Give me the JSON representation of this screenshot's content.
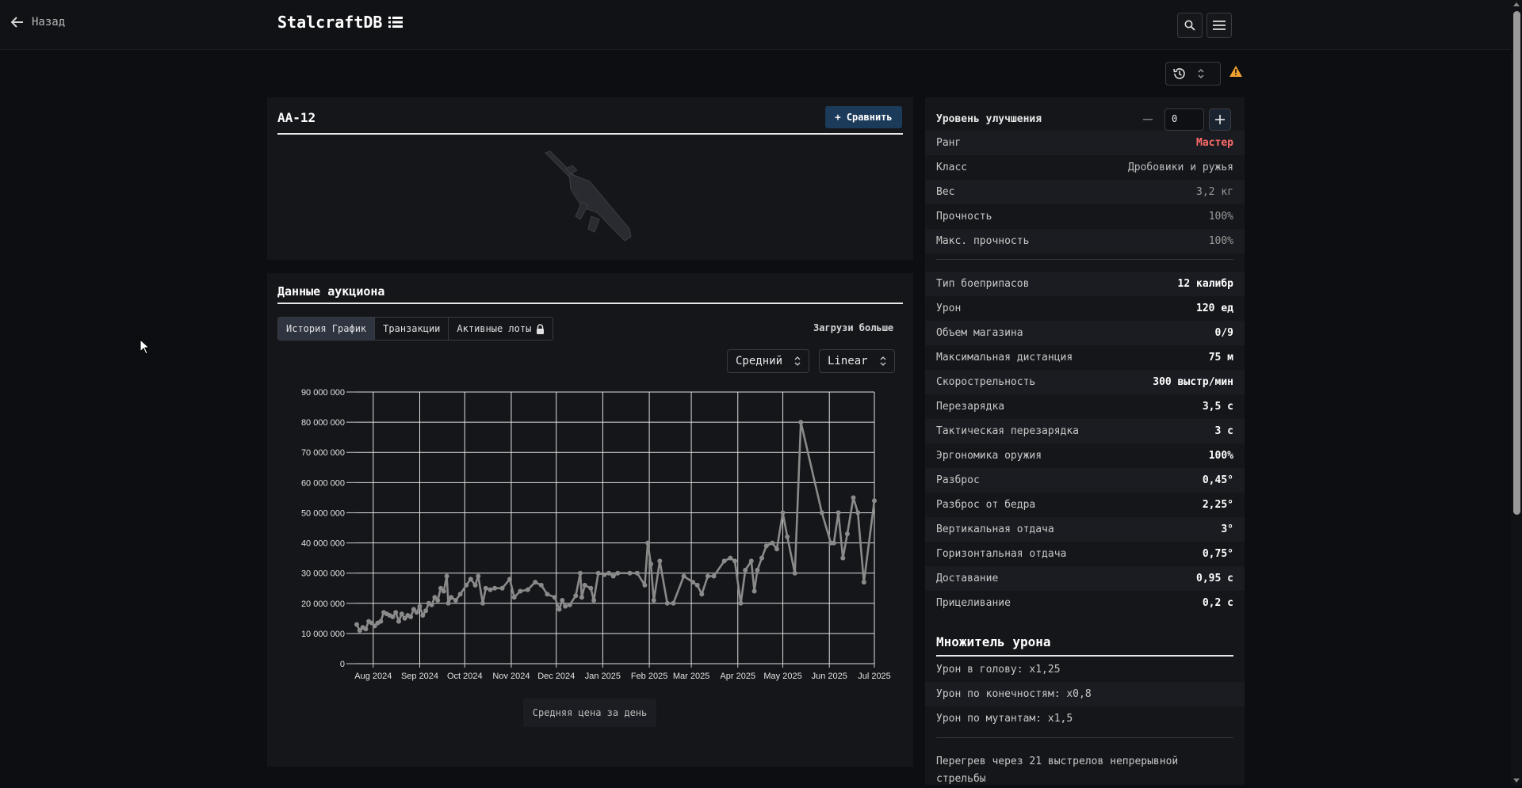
{
  "nav": {
    "back_label": "Назад",
    "brand": "StalcraftDB"
  },
  "item": {
    "name": "AA-12",
    "compare_label": "+ Сравнить"
  },
  "auction": {
    "title": "Данные аукциона",
    "tabs": [
      {
        "label": "История График",
        "active": true
      },
      {
        "label": "Транзакции",
        "active": false
      },
      {
        "label": "Активные лоты",
        "active": false
      }
    ],
    "load_more": "Загрузи больше",
    "mode_select": "Средний",
    "scale_select": "Linear",
    "caption": "Средняя цена за день"
  },
  "chart_data": {
    "type": "line",
    "ylim": [
      0,
      90000000
    ],
    "y_ticks": [
      {
        "v": 0,
        "label": "0"
      },
      {
        "v": 10000000,
        "label": "10 000 000"
      },
      {
        "v": 20000000,
        "label": "20 000 000"
      },
      {
        "v": 30000000,
        "label": "30 000 000"
      },
      {
        "v": 40000000,
        "label": "40 000 000"
      },
      {
        "v": 50000000,
        "label": "50 000 000"
      },
      {
        "v": 60000000,
        "label": "60 000 000"
      },
      {
        "v": 70000000,
        "label": "70 000 000"
      },
      {
        "v": 80000000,
        "label": "80 000 000"
      },
      {
        "v": 90000000,
        "label": "90 000 000"
      }
    ],
    "x_ticks": [
      {
        "x": "2024-08-01",
        "label": "Aug 2024"
      },
      {
        "x": "2024-09-01",
        "label": "Sep 2024"
      },
      {
        "x": "2024-10-01",
        "label": "Oct 2024"
      },
      {
        "x": "2024-11-01",
        "label": "Nov 2024"
      },
      {
        "x": "2024-12-01",
        "label": "Dec 2024"
      },
      {
        "x": "2025-01-01",
        "label": "Jan 2025"
      },
      {
        "x": "2025-02-01",
        "label": "Feb 2025"
      },
      {
        "x": "2025-03-01",
        "label": "Mar 2025"
      },
      {
        "x": "2025-04-01",
        "label": "Apr 2025"
      },
      {
        "x": "2025-05-01",
        "label": "May 2025"
      },
      {
        "x": "2025-06-01",
        "label": "Jun 2025"
      },
      {
        "x": "2025-07-01",
        "label": "Jul 2025"
      }
    ],
    "xlim": [
      "2024-07-21",
      "2025-07-01"
    ],
    "grid": true,
    "series": [
      {
        "color": "#8a8a8a",
        "points": [
          [
            "2024-07-21",
            13000000
          ],
          [
            "2024-07-23",
            11000000
          ],
          [
            "2024-07-25",
            12000000
          ],
          [
            "2024-07-27",
            11500000
          ],
          [
            "2024-07-29",
            14000000
          ],
          [
            "2024-07-31",
            13500000
          ],
          [
            "2024-08-02",
            12500000
          ],
          [
            "2024-08-04",
            13500000
          ],
          [
            "2024-08-06",
            14000000
          ],
          [
            "2024-08-08",
            17000000
          ],
          [
            "2024-08-10",
            16500000
          ],
          [
            "2024-08-12",
            16000000
          ],
          [
            "2024-08-14",
            15500000
          ],
          [
            "2024-08-16",
            17000000
          ],
          [
            "2024-08-18",
            14000000
          ],
          [
            "2024-08-20",
            16500000
          ],
          [
            "2024-08-22",
            15000000
          ],
          [
            "2024-08-24",
            16000000
          ],
          [
            "2024-08-26",
            15500000
          ],
          [
            "2024-08-28",
            18000000
          ],
          [
            "2024-08-30",
            17000000
          ],
          [
            "2024-09-01",
            19000000
          ],
          [
            "2024-09-03",
            16000000
          ],
          [
            "2024-09-05",
            17500000
          ],
          [
            "2024-09-07",
            20000000
          ],
          [
            "2024-09-09",
            19500000
          ],
          [
            "2024-09-11",
            22000000
          ],
          [
            "2024-09-13",
            21000000
          ],
          [
            "2024-09-15",
            25000000
          ],
          [
            "2024-09-17",
            24000000
          ],
          [
            "2024-09-19",
            29000000
          ],
          [
            "2024-09-20",
            20000000
          ],
          [
            "2024-09-22",
            22000000
          ],
          [
            "2024-09-25",
            21000000
          ],
          [
            "2024-09-28",
            23000000
          ],
          [
            "2024-10-02",
            26000000
          ],
          [
            "2024-10-05",
            28000000
          ],
          [
            "2024-10-08",
            26000000
          ],
          [
            "2024-10-10",
            29000000
          ],
          [
            "2024-10-13",
            20000000
          ],
          [
            "2024-10-15",
            25000000
          ],
          [
            "2024-10-18",
            24500000
          ],
          [
            "2024-10-21",
            25000000
          ],
          [
            "2024-10-26",
            25000000
          ],
          [
            "2024-10-31",
            28000000
          ],
          [
            "2024-11-03",
            22000000
          ],
          [
            "2024-11-07",
            24000000
          ],
          [
            "2024-11-12",
            24500000
          ],
          [
            "2024-11-17",
            27000000
          ],
          [
            "2024-11-21",
            26000000
          ],
          [
            "2024-11-25",
            23000000
          ],
          [
            "2024-11-30",
            22000000
          ],
          [
            "2024-12-03",
            18000000
          ],
          [
            "2024-12-05",
            21000000
          ],
          [
            "2024-12-07",
            19000000
          ],
          [
            "2024-12-10",
            19500000
          ],
          [
            "2024-12-14",
            22500000
          ],
          [
            "2024-12-17",
            30000000
          ],
          [
            "2024-12-18",
            22000000
          ],
          [
            "2024-12-20",
            26000000
          ],
          [
            "2024-12-24",
            25000000
          ],
          [
            "2024-12-26",
            21000000
          ],
          [
            "2024-12-29",
            30000000
          ],
          [
            "2025-01-02",
            29500000
          ],
          [
            "2025-01-05",
            30000000
          ],
          [
            "2025-01-08",
            29000000
          ],
          [
            "2025-01-11",
            30000000
          ],
          [
            "2025-01-19",
            30000000
          ],
          [
            "2025-01-24",
            30000000
          ],
          [
            "2025-01-29",
            26000000
          ],
          [
            "2025-01-31",
            40000000
          ],
          [
            "2025-02-02",
            33000000
          ],
          [
            "2025-02-04",
            21000000
          ],
          [
            "2025-02-08",
            34000000
          ],
          [
            "2025-02-13",
            20000000
          ],
          [
            "2025-02-17",
            20000000
          ],
          [
            "2025-02-24",
            29000000
          ],
          [
            "2025-03-02",
            27000000
          ],
          [
            "2025-03-05",
            26000000
          ],
          [
            "2025-03-08",
            23000000
          ],
          [
            "2025-03-12",
            29000000
          ],
          [
            "2025-03-16",
            29000000
          ],
          [
            "2025-03-23",
            34000000
          ],
          [
            "2025-03-27",
            35000000
          ],
          [
            "2025-03-30",
            34000000
          ],
          [
            "2025-04-03",
            20000000
          ],
          [
            "2025-04-06",
            31000000
          ],
          [
            "2025-04-10",
            34000000
          ],
          [
            "2025-04-12",
            24000000
          ],
          [
            "2025-04-14",
            31000000
          ],
          [
            "2025-04-17",
            35000000
          ],
          [
            "2025-04-20",
            39000000
          ],
          [
            "2025-04-24",
            40000000
          ],
          [
            "2025-04-27",
            38000000
          ],
          [
            "2025-05-01",
            50000000
          ],
          [
            "2025-05-04",
            42000000
          ],
          [
            "2025-05-09",
            30000000
          ],
          [
            "2025-05-13",
            80000000
          ],
          [
            "2025-05-27",
            50000000
          ],
          [
            "2025-06-02",
            40000000
          ],
          [
            "2025-06-04",
            40000000
          ],
          [
            "2025-06-07",
            50000000
          ],
          [
            "2025-06-10",
            35000000
          ],
          [
            "2025-06-13",
            43000000
          ],
          [
            "2025-06-17",
            55000000
          ],
          [
            "2025-06-20",
            50000000
          ],
          [
            "2025-06-24",
            27000000
          ],
          [
            "2025-07-01",
            54000000
          ]
        ]
      }
    ]
  },
  "stats": {
    "upgrade_label": "Уровень улучшения",
    "upgrade_value": "0",
    "rows1": [
      {
        "label": "Ранг",
        "value": "Мастер",
        "style": "rank"
      },
      {
        "label": "Класс",
        "value": "Дробовики и ружья",
        "style": "gray"
      },
      {
        "label": "Вес",
        "value": "3,2 кг",
        "style": "dim"
      },
      {
        "label": "Прочность",
        "value": "100%",
        "style": "dim"
      },
      {
        "label": "Макс. прочность",
        "value": "100%",
        "style": "dim"
      }
    ],
    "rows2": [
      {
        "label": "Тип боеприпасов",
        "value": "12 калибр"
      },
      {
        "label": "Урон",
        "value": "120 ед"
      },
      {
        "label": "Объем магазина",
        "value": "0/9"
      },
      {
        "label": "Максимальная дистанция",
        "value": "75 м"
      },
      {
        "label": "Скорострельность",
        "value": "300 выстр/мин"
      },
      {
        "label": "Перезарядка",
        "value": "3,5 с"
      },
      {
        "label": "Тактическая перезарядка",
        "value": "3 с"
      },
      {
        "label": "Эргономика оружия",
        "value": "100%"
      },
      {
        "label": "Разброс",
        "value": "0,45°"
      },
      {
        "label": "Разброс от бедра",
        "value": "2,25°"
      },
      {
        "label": "Вертикальная отдача",
        "value": "3°"
      },
      {
        "label": "Горизонтальная отдача",
        "value": "0,75°"
      },
      {
        "label": "Доставание",
        "value": "0,95 с"
      },
      {
        "label": "Прицеливание",
        "value": "0,2 с"
      }
    ],
    "multiplier_title": "Множитель урона",
    "multipliers": [
      "Урон в голову: x1,25",
      "Урон по конечностям: x0,8",
      "Урон по мутантам: x1,5"
    ],
    "overheat": "Перегрев через 21 выстрелов непрерывной стрельбы"
  }
}
